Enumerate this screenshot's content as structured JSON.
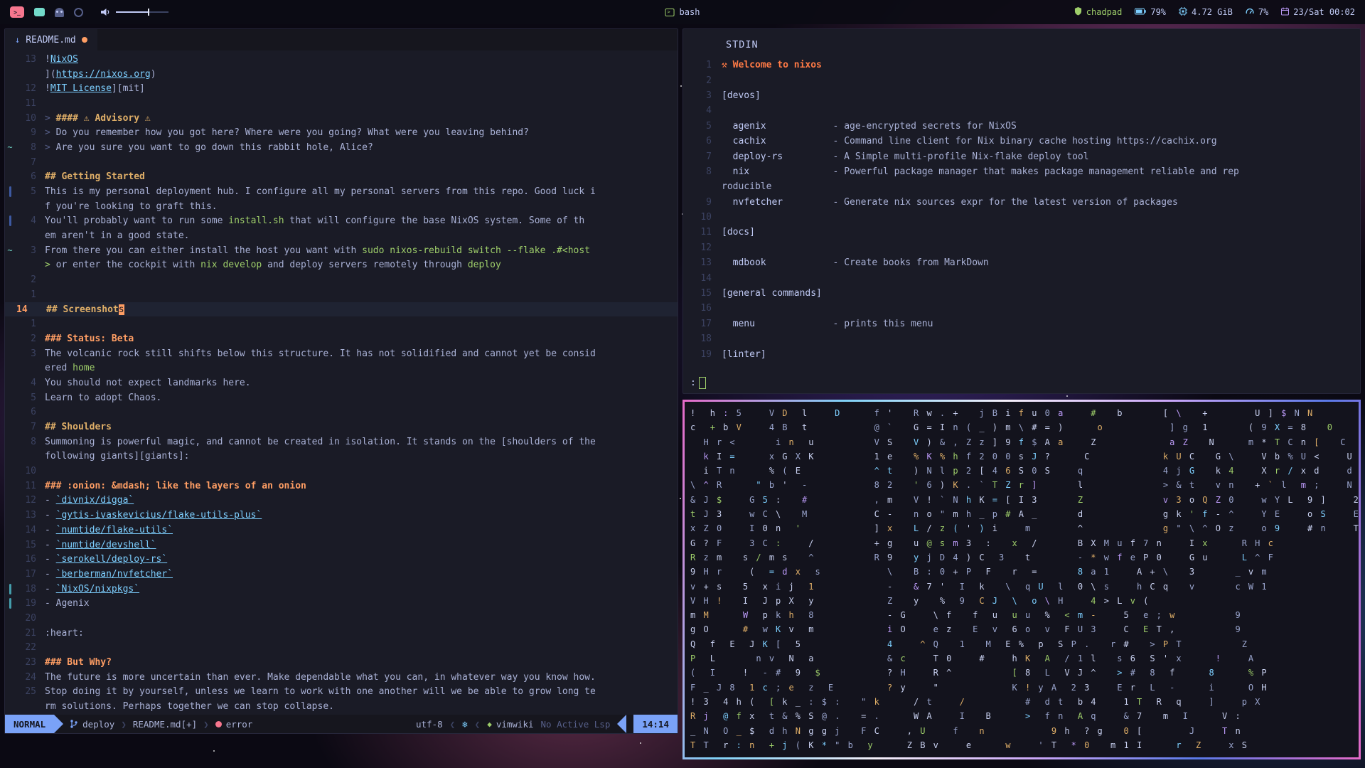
{
  "colors": {
    "accent": "#7aa2f7",
    "bg": "#1a1b26",
    "bar_bg": "#16161e",
    "mode_bg": "#7aa2f7",
    "error": "#f7768e",
    "heading": "#e0af68",
    "heading2": "#ff9e64",
    "code": "#9ece6a",
    "link": "#7dcfff",
    "current_line_nr": "#ff9e64"
  },
  "topbar": {
    "center_label": "bash",
    "modules_right": [
      {
        "icon": "shield-icon",
        "label": "chadpad",
        "color": "#9ece6a",
        "green": true
      },
      {
        "icon": "battery-icon",
        "label": "79%",
        "color": "#7dcfff",
        "green": false
      },
      {
        "icon": "memory-icon",
        "label": "4.72 GiB",
        "color": "#7dcfff",
        "green": false
      },
      {
        "icon": "cpu-icon",
        "label": "7%",
        "color": "#7dcfff",
        "green": false
      },
      {
        "icon": "calendar-icon",
        "label": "23/Sat 00:02",
        "color": "#bb9af7",
        "green": false
      }
    ]
  },
  "editor": {
    "tab": {
      "file": "README.md"
    },
    "statusline": {
      "mode": "NORMAL",
      "branch": "deploy",
      "file": "README.md[+]",
      "diag": "error",
      "enc": "utf-8",
      "os_icon": "❄",
      "ft": "vimwiki",
      "lsp": "No Active Lsp",
      "time": "14:14",
      "chev_r": "❯",
      "chev_l": "❮",
      "vim_icon": "◆"
    },
    "rows": [
      {
        "n": "13",
        "s": "",
        "segs": [
          {
            "t": "!",
            "c": "t"
          },
          {
            "t": "NixOS",
            "c": "link"
          }
        ]
      },
      {
        "n": "",
        "s": "",
        "segs": [
          {
            "t": "](",
            "c": "t"
          },
          {
            "t": "https://nixos.org",
            "c": "link"
          },
          {
            "t": ")",
            "c": "t"
          }
        ]
      },
      {
        "n": "12",
        "s": "",
        "segs": [
          {
            "t": "!",
            "c": "t"
          },
          {
            "t": "MIT License",
            "c": "link"
          },
          {
            "t": "][mit]",
            "c": "t"
          }
        ]
      },
      {
        "n": "11",
        "s": "",
        "segs": []
      },
      {
        "n": "10",
        "s": "",
        "segs": [
          {
            "t": "> ",
            "c": "q"
          },
          {
            "t": "#### ⚠ Advisory ⚠",
            "c": "h4"
          }
        ]
      },
      {
        "n": "9",
        "s": "",
        "segs": [
          {
            "t": "> ",
            "c": "q"
          },
          {
            "t": "Do you remember how you got here? Where were you going? What were you leaving behind?",
            "c": "t"
          }
        ]
      },
      {
        "n": "8",
        "s": "~",
        "segs": [
          {
            "t": "> ",
            "c": "q"
          },
          {
            "t": "Are you sure you want to go down this rabbit hole, Alice?",
            "c": "t"
          }
        ]
      },
      {
        "n": "7",
        "s": "",
        "segs": []
      },
      {
        "n": "6",
        "s": "",
        "segs": [
          {
            "t": "## Getting Started",
            "c": "h2"
          }
        ]
      },
      {
        "n": "5",
        "s": "bar-blue",
        "segs": [
          {
            "t": "This is my personal deployment hub. I configure all my personal servers from this repo. Good luck i",
            "c": "t"
          }
        ]
      },
      {
        "n": "",
        "s": "",
        "segs": [
          {
            "t": "f you're looking to graft this.",
            "c": "t"
          }
        ]
      },
      {
        "n": "4",
        "s": "bar-blue",
        "segs": [
          {
            "t": "You'll probably want to run some ",
            "c": "t"
          },
          {
            "t": "install.sh",
            "c": "code"
          },
          {
            "t": " that will configure the base NixOS system. Some of th",
            "c": "t"
          }
        ]
      },
      {
        "n": "",
        "s": "",
        "segs": [
          {
            "t": "em aren't in a good state.",
            "c": "t"
          }
        ]
      },
      {
        "n": "3",
        "s": "~",
        "segs": [
          {
            "t": "From there you can either install the host you want with ",
            "c": "t"
          },
          {
            "t": "sudo nixos-rebuild switch --flake .#<host",
            "c": "code"
          }
        ]
      },
      {
        "n": "",
        "s": "",
        "segs": [
          {
            "t": ">",
            "c": "code"
          },
          {
            "t": " or enter the cockpit with ",
            "c": "t"
          },
          {
            "t": "nix develop",
            "c": "code"
          },
          {
            "t": " and deploy servers remotely through ",
            "c": "t"
          },
          {
            "t": "deploy",
            "c": "code"
          }
        ]
      },
      {
        "n": "2",
        "s": "",
        "segs": []
      },
      {
        "n": "1",
        "s": "",
        "segs": []
      },
      {
        "n": "14",
        "s": "",
        "cur": true,
        "segs": [
          {
            "t": "## Screenshot",
            "c": "h2"
          },
          {
            "t": "s",
            "c": "cursor"
          }
        ]
      },
      {
        "n": "1",
        "s": "",
        "segs": []
      },
      {
        "n": "2",
        "s": "",
        "segs": [
          {
            "t": "### Status: Beta",
            "c": "h3"
          }
        ]
      },
      {
        "n": "3",
        "s": "",
        "segs": [
          {
            "t": "The volcanic rock still shifts below this structure. It has not solidified and cannot yet be consid",
            "c": "t"
          }
        ]
      },
      {
        "n": "",
        "s": "",
        "segs": [
          {
            "t": "ered ",
            "c": "t"
          },
          {
            "t": "home",
            "c": "code"
          }
        ]
      },
      {
        "n": "4",
        "s": "",
        "segs": [
          {
            "t": "You should not expect landmarks here.",
            "c": "t"
          }
        ]
      },
      {
        "n": "5",
        "s": "",
        "segs": [
          {
            "t": "Learn to adopt Chaos.",
            "c": "t"
          }
        ]
      },
      {
        "n": "6",
        "s": "",
        "segs": []
      },
      {
        "n": "7",
        "s": "",
        "segs": [
          {
            "t": "## Shoulders",
            "c": "h2"
          }
        ]
      },
      {
        "n": "8",
        "s": "",
        "segs": [
          {
            "t": "Summoning is powerful magic, and cannot be created in isolation. It stands on the [shoulders of the",
            "c": "t"
          }
        ]
      },
      {
        "n": "",
        "s": "",
        "segs": [
          {
            "t": "following giants][giants]:",
            "c": "t"
          }
        ]
      },
      {
        "n": "10",
        "s": "",
        "segs": []
      },
      {
        "n": "11",
        "s": "",
        "segs": [
          {
            "t": "### :onion: &mdash; like the layers of an onion",
            "c": "h3"
          }
        ]
      },
      {
        "n": "12",
        "s": "",
        "segs": [
          {
            "t": "- ",
            "c": "t"
          },
          {
            "t": "`divnix/digga`",
            "c": "link"
          }
        ]
      },
      {
        "n": "13",
        "s": "",
        "segs": [
          {
            "t": "- ",
            "c": "t"
          },
          {
            "t": "`gytis-ivaskevicius/flake-utils-plus`",
            "c": "link"
          }
        ]
      },
      {
        "n": "14",
        "s": "",
        "segs": [
          {
            "t": "- ",
            "c": "t"
          },
          {
            "t": "`numtide/flake-utils`",
            "c": "link"
          }
        ]
      },
      {
        "n": "15",
        "s": "",
        "segs": [
          {
            "t": "- ",
            "c": "t"
          },
          {
            "t": "`numtide/devshell`",
            "c": "link"
          }
        ]
      },
      {
        "n": "16",
        "s": "",
        "segs": [
          {
            "t": "- ",
            "c": "t"
          },
          {
            "t": "`serokell/deploy-rs`",
            "c": "link"
          }
        ]
      },
      {
        "n": "17",
        "s": "",
        "segs": [
          {
            "t": "- ",
            "c": "t"
          },
          {
            "t": "`berberman/nvfetcher`",
            "c": "link"
          }
        ]
      },
      {
        "n": "18",
        "s": "bar-teal",
        "segs": [
          {
            "t": "- ",
            "c": "t"
          },
          {
            "t": "`NixOS/nixpkgs`",
            "c": "link"
          }
        ]
      },
      {
        "n": "19",
        "s": "bar-teal",
        "segs": [
          {
            "t": "- Agenix",
            "c": "t"
          }
        ]
      },
      {
        "n": "20",
        "s": "",
        "segs": []
      },
      {
        "n": "21",
        "s": "",
        "segs": [
          {
            "t": ":heart:",
            "c": "t"
          }
        ]
      },
      {
        "n": "22",
        "s": "",
        "segs": []
      },
      {
        "n": "23",
        "s": "",
        "segs": [
          {
            "t": "### But Why?",
            "c": "h3"
          }
        ]
      },
      {
        "n": "24",
        "s": "",
        "segs": [
          {
            "t": "The future is more uncertain than ever. Make dependable what you can, in whatever way you know how.",
            "c": "t"
          }
        ]
      },
      {
        "n": "25",
        "s": "",
        "segs": [
          {
            "t": "Stop doing it by yourself, unless we learn to work with one another will we be able to grow long te",
            "c": "t"
          }
        ]
      },
      {
        "n": "",
        "s": "",
        "segs": [
          {
            "t": "rm solutions. Perhaps together we can stop collapse.",
            "c": "t"
          }
        ]
      }
    ]
  },
  "stdin_win": {
    "title": "STDIN",
    "prompt": ":",
    "rows": [
      {
        "n": "1",
        "segs": [
          {
            "t": "⚒ Welcome to nixos",
            "c": "wel"
          }
        ]
      },
      {
        "n": "2",
        "segs": []
      },
      {
        "n": "3",
        "segs": [
          {
            "t": "[devos]",
            "c": "sec"
          }
        ]
      },
      {
        "n": "4",
        "segs": []
      },
      {
        "n": "5",
        "segs": [
          {
            "t": "  agenix",
            "c": "name"
          },
          {
            "t": "            - age-encrypted secrets for NixOS",
            "c": "desc"
          }
        ]
      },
      {
        "n": "6",
        "segs": [
          {
            "t": "  cachix",
            "c": "name"
          },
          {
            "t": "            - Command line client for Nix binary cache hosting https://cachix.org",
            "c": "desc"
          }
        ]
      },
      {
        "n": "7",
        "segs": [
          {
            "t": "  deploy-rs",
            "c": "name"
          },
          {
            "t": "         - A Simple multi-profile Nix-flake deploy tool",
            "c": "desc"
          }
        ]
      },
      {
        "n": "8",
        "segs": [
          {
            "t": "  nix",
            "c": "name"
          },
          {
            "t": "               - Powerful package manager that makes package management reliable and rep",
            "c": "desc"
          }
        ]
      },
      {
        "n": "",
        "segs": [
          {
            "t": "roducible",
            "c": "desc"
          }
        ]
      },
      {
        "n": "9",
        "segs": [
          {
            "t": "  nvfetcher",
            "c": "name"
          },
          {
            "t": "         - Generate nix sources expr for the latest version of packages",
            "c": "desc"
          }
        ]
      },
      {
        "n": "10",
        "segs": []
      },
      {
        "n": "11",
        "segs": [
          {
            "t": "[docs]",
            "c": "sec"
          }
        ]
      },
      {
        "n": "12",
        "segs": []
      },
      {
        "n": "13",
        "segs": [
          {
            "t": "  mdbook",
            "c": "name"
          },
          {
            "t": "            - Create books from MarkDown",
            "c": "desc"
          }
        ]
      },
      {
        "n": "14",
        "segs": []
      },
      {
        "n": "15",
        "segs": [
          {
            "t": "[general commands]",
            "c": "sec"
          }
        ]
      },
      {
        "n": "16",
        "segs": []
      },
      {
        "n": "17",
        "segs": [
          {
            "t": "  menu",
            "c": "name"
          },
          {
            "t": "              - prints this menu",
            "c": "desc"
          }
        ]
      },
      {
        "n": "18",
        "segs": []
      },
      {
        "n": "19",
        "segs": [
          {
            "t": "[linter]",
            "c": "sec"
          }
        ]
      }
    ]
  },
  "glitch": {
    "palette": {
      "light": "#c8d0f0",
      "dim": "#9aa5ce",
      "cyan": "#7dcfff",
      "yellow": "#e0af68",
      "green": "#9ece6a",
      "purple": "#bb9af7"
    },
    "rows": [
      "!  h : 5    V D  l    D     f '   R w . +   j B i f u 0 a    #   b      [ \\   +       U ] $ N N",
      "c  + b V    4 B  t          @ `   G = I n ( _ ) m \\ # = )     o          ] g  1      ( 9 X = 8   0",
      "  H r <      i n  u         V S   V ) & , Z z ] 9 f $ A a    Z           a Z   N     m * T C n [   C",
      "  k I =     x G X K         1 e   % K % h f 2 0 0 s J ?     C           k U C   G \\    V b % U <    U",
      "  i T n     % ( E           ^ t   ) N l p 2 [ 4 6 S 0 S    q            4 j G   k 4    X r / x d    d",
      "\\ ^ R     \" b '  -          8 2   ' 6 ) K . ` T Z r ]      l            > & t   v n   + ` l  m ;    N",
      "& J $    G 5 :   #          , m   V ! ` N h K = [ I 3      Z            v 3 o Q Z 0    w Y L  9 ]    2",
      "t J 3    w C \\   M          C -   n o \" m h _ p # A _      d            g k ' f - ^    Y E    o S    E",
      "x Z 0    I 0 n  '           ] x   L / z ( ' ) i    m       ^            g \" \\ ^ O z    o 9    # n    T",
      "G ? F    3 C :    /         + g   u @ s m 3  :   x  /      B X M u f 7 n    I x     R H c",
      "R z m   s / m s   ^         R 9   y j D 4 ) C  3   t       - * w f e P 0    G u     L ^ F",
      "9 H r    (  = d x  s          \\   B : 0 + P  F   r  =      8 a 1    A + \\   3      _ v m",
      "v + s   5  x i j  1           -   & 7 '  I  k   \\  q U  l  0 \\ s    h C q   v      c W 1",
      "V H !   I  J p X  y           Z   y   %  9  C J  \\  o \\ H    4 > L v (",
      "m M     W  p k h  8           - G    \\ f   f  u  u u  %  < m -    5  e ; w         9",
      "g O     #  w K v  m           i O    e z   E  v  6 o  v  F U 3    C  E T ,         9",
      "Q  f  E  J K [  5             4    ^ Q   1   M  E %  p  S P .   r #   > P T         Z",
      "P  L      n v  N  a           & c    T 0    #    h K  A  / 1 l   s 6  S ' x     !    A",
      "(  I    !  - #  9  $          ? H    R ^         [ 8  L  V J ^   > #  8  f     8     % P",
      "F _ J 8  1 c ; e  z  E        ? y    \"           K ! y A  2 3    E r  L  -     i     O H",
      "! 3  4 h (  [ k _ : $ :   \" k     / t    /         #  d t  b 4    1 T  R  q    ]    p X",
      "R j  @ f x  t & % S @ .   = .     W A    I   B     >  f n  A q    & 7   m  I     V :",
      "_ N  O _ $  d h N g g j   F C    , U    f   n          9 h  ? g   0 [       J    T n",
      "T T  r : n  + j ( K * \" b  y     Z B v    e     w    ' T  * 0   m 1 I     r  Z    x S"
    ]
  }
}
